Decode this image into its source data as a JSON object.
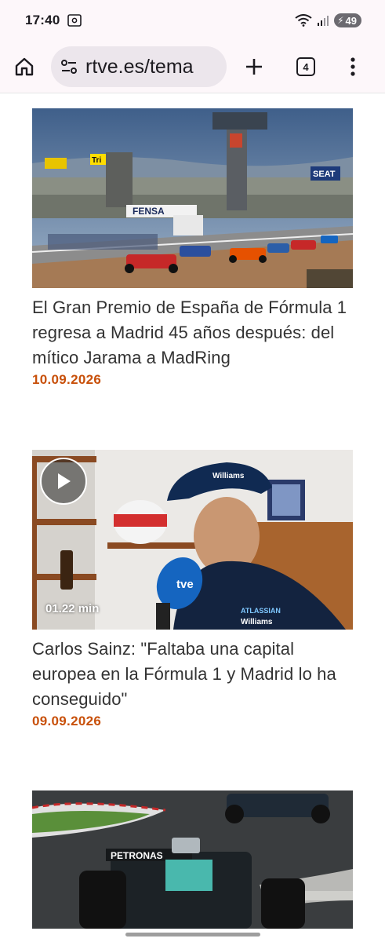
{
  "status_bar": {
    "time": "17:40",
    "battery": "49"
  },
  "browser": {
    "url": "rtve.es/tema",
    "tab_count": "4"
  },
  "articles": [
    {
      "title": "El Gran Premio de España de Fórmula 1 regresa a Madrid 45 años después: del mítico Jarama a MadRing",
      "date": "10.09.2026",
      "image_signs": {
        "banner_left": "Tri",
        "grandstand": "FENSA",
        "sponsor_right": "SEAT"
      }
    },
    {
      "title": "Carlos Sainz: \"Faltaba una capital europea en la Fórmula 1 y Madrid lo ha conseguido\"",
      "date": "09.09.2026",
      "duration": "01.22 min",
      "image_signs": {
        "mic": "tve",
        "cap": "Williams",
        "shirt_1": "ATLASSIAN",
        "shirt_2": "Williams",
        "car_sponsor": "PETRONAS"
      }
    },
    {
      "title": "",
      "date": ""
    }
  ],
  "colors": {
    "accent_date": "#c8500a",
    "browser_bg": "#fdf7fa",
    "urlbar_bg": "#ece6ec"
  }
}
